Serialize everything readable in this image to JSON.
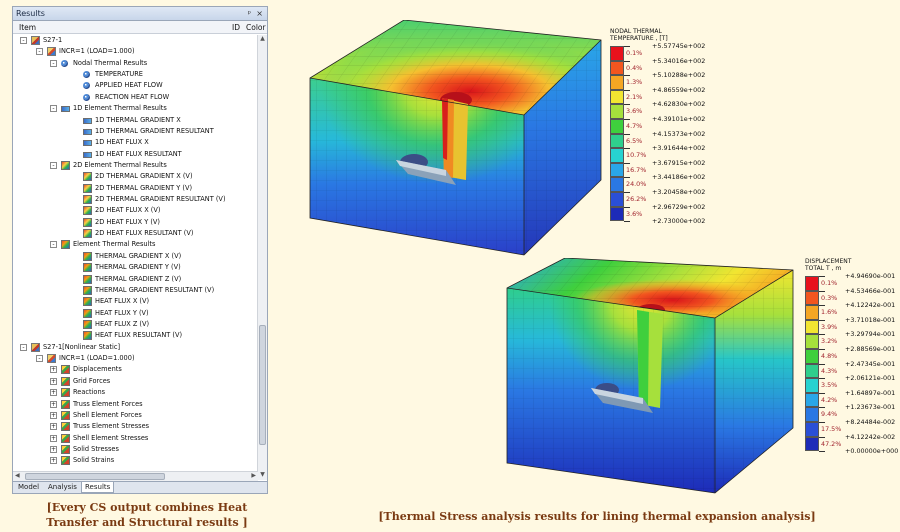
{
  "panel": {
    "title": "Results",
    "pin": "📌",
    "close": "×",
    "col_item": "Item",
    "col_id": "ID",
    "col_color": "Color",
    "tabs": [
      {
        "label": "Model"
      },
      {
        "label": "Analysis"
      },
      {
        "label": "Results"
      }
    ]
  },
  "tree": [
    {
      "label": "S27-1",
      "icon": "load-case-icon",
      "expander": "-"
    },
    {
      "label": "INCR=1 (LOAD=1.000)",
      "icon": "increment-icon",
      "expander": "-"
    },
    {
      "label": "Nodal Thermal Results",
      "icon": "thermal-icon",
      "expander": "-"
    },
    {
      "label": "TEMPERATURE",
      "icon": "thermal-icon"
    },
    {
      "label": "APPLIED HEAT FLOW",
      "icon": "thermal-icon"
    },
    {
      "label": "REACTION HEAT FLOW",
      "icon": "thermal-icon"
    },
    {
      "label": "1D Element Thermal Results",
      "icon": "1d-element-icon",
      "expander": "-"
    },
    {
      "label": "1D THERMAL GRADIENT X",
      "icon": "1d-element-icon"
    },
    {
      "label": "1D THERMAL GRADIENT RESULTANT",
      "icon": "1d-element-icon"
    },
    {
      "label": "1D HEAT FLUX X",
      "icon": "1d-element-icon"
    },
    {
      "label": "1D HEAT FLUX RESULTANT",
      "icon": "1d-element-icon"
    },
    {
      "label": "2D Element Thermal Results",
      "icon": "2d-element-icon",
      "expander": "-"
    },
    {
      "label": "2D THERMAL GRADIENT X (V)",
      "icon": "2d-element-icon"
    },
    {
      "label": "2D THERMAL GRADIENT Y (V)",
      "icon": "2d-element-icon"
    },
    {
      "label": "2D THERMAL GRADIENT RESULTANT (V)",
      "icon": "2d-element-icon"
    },
    {
      "label": "2D HEAT FLUX X (V)",
      "icon": "2d-element-icon"
    },
    {
      "label": "2D HEAT FLUX Y (V)",
      "icon": "2d-element-icon"
    },
    {
      "label": "2D HEAT FLUX RESULTANT (V)",
      "icon": "2d-element-icon"
    },
    {
      "label": "Element Thermal Results",
      "icon": "element-icon",
      "expander": "-"
    },
    {
      "label": "THERMAL GRADIENT X (V)",
      "icon": "element-icon"
    },
    {
      "label": "THERMAL GRADIENT Y (V)",
      "icon": "element-icon"
    },
    {
      "label": "THERMAL GRADIENT Z (V)",
      "icon": "element-icon"
    },
    {
      "label": "THERMAL GRADIENT RESULTANT (V)",
      "icon": "element-icon"
    },
    {
      "label": "HEAT FLUX X (V)",
      "icon": "element-icon"
    },
    {
      "label": "HEAT FLUX Y (V)",
      "icon": "element-icon"
    },
    {
      "label": "HEAT FLUX Z (V)",
      "icon": "element-icon"
    },
    {
      "label": "HEAT FLUX RESULTANT (V)",
      "icon": "element-icon"
    },
    {
      "label": "S27-1[Nonlinear Static]",
      "icon": "load-case-icon",
      "expander": "-"
    },
    {
      "label": "INCR=1 (LOAD=1.000)",
      "icon": "increment-icon",
      "expander": "-"
    },
    {
      "label": "Displacements",
      "icon": "category-icon",
      "expander": "+"
    },
    {
      "label": "Grid Forces",
      "icon": "category-icon",
      "expander": "+"
    },
    {
      "label": "Reactions",
      "icon": "category-icon",
      "expander": "+"
    },
    {
      "label": "Truss Element Forces",
      "icon": "category-icon",
      "expander": "+"
    },
    {
      "label": "Shell Element Forces",
      "icon": "category-icon",
      "expander": "+"
    },
    {
      "label": "Truss Element Stresses",
      "icon": "category-icon",
      "expander": "+"
    },
    {
      "label": "Shell Element Stresses",
      "icon": "category-icon",
      "expander": "+"
    },
    {
      "label": "Solid Stresses",
      "icon": "category-icon",
      "expander": "+"
    },
    {
      "label": "Solid Strains",
      "icon": "category-icon",
      "expander": "+"
    }
  ],
  "captions": {
    "left_line1": "[Every CS output combines Heat",
    "left_line2": "Transfer and Structural results ]",
    "right": "[Thermal Stress analysis results for lining thermal expansion analysis]"
  },
  "legend_temp": {
    "title1": "NODAL THERMAL",
    "title2": "TEMPERATURE , [T]",
    "values": [
      "+5.57745e+002",
      "+5.34016e+002",
      "+5.10288e+002",
      "+4.86559e+002",
      "+4.62830e+002",
      "+4.39101e+002",
      "+4.15373e+002",
      "+3.91644e+002",
      "+3.67915e+002",
      "+3.44186e+002",
      "+3.20458e+002",
      "+2.96729e+002",
      "+2.73000e+002"
    ],
    "percents": [
      "0.1%",
      "0.4%",
      "1.3%",
      "2.1%",
      "3.6%",
      "4.7%",
      "6.5%",
      "10.7%",
      "16.7%",
      "24.0%",
      "26.2%",
      "3.6%"
    ],
    "colors": [
      "#e8121c",
      "#f2561f",
      "#f5a623",
      "#f2e531",
      "#a6e03c",
      "#3fcf3d",
      "#2fce8d",
      "#27d2d0",
      "#2aa7e8",
      "#2a78e3",
      "#2a4fd6",
      "#1d2bb8"
    ]
  },
  "legend_disp": {
    "title1": "DISPLACEMENT",
    "title2": "TOTAL T , m",
    "values": [
      "+4.94690e-001",
      "+4.53466e-001",
      "+4.12242e-001",
      "+3.71018e-001",
      "+3.29794e-001",
      "+2.88569e-001",
      "+2.47345e-001",
      "+2.06121e-001",
      "+1.64897e-001",
      "+1.23673e-001",
      "+8.24484e-002",
      "+4.12242e-002",
      "+0.00000e+000"
    ],
    "percents": [
      "0.1%",
      "0.3%",
      "1.6%",
      "3.9%",
      "3.2%",
      "4.8%",
      "4.3%",
      "3.5%",
      "4.2%",
      "9.4%",
      "17.5%",
      "47.2%"
    ],
    "colors": [
      "#e8121c",
      "#f2561f",
      "#f5a623",
      "#f2e531",
      "#a6e03c",
      "#3fcf3d",
      "#2fce8d",
      "#27d2d0",
      "#2aa7e8",
      "#2a78e3",
      "#2a4fd6",
      "#1d2bb8"
    ]
  }
}
